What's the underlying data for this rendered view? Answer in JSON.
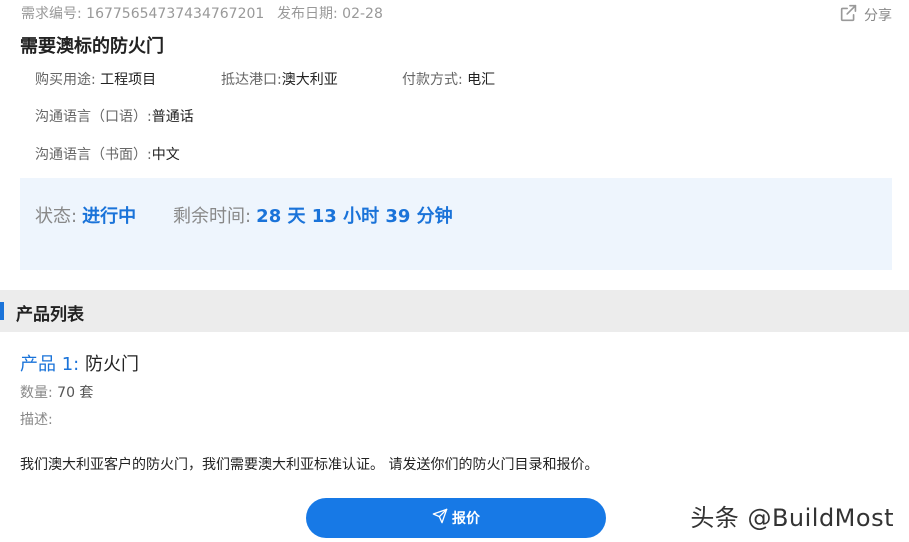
{
  "meta": {
    "req_no": "需求编号: 16775654737434767201",
    "pub_date": "发布日期: 02-28"
  },
  "share": {
    "label": "分享",
    "icon": "share-icon"
  },
  "title": "需要澳标的防火门",
  "info": {
    "purpose_label": "购买用途:",
    "purpose_value": "工程项目",
    "port_label": "抵达港口:",
    "port_value": "澳大利亚",
    "payment_label": "付款方式:",
    "payment_value": "电汇",
    "spoken_label": "沟通语言（口语）:",
    "spoken_value": "普通话",
    "written_label": "沟通语言（书面）:",
    "written_value": "中文"
  },
  "status": {
    "status_label": "状态:",
    "status_value": "进行中",
    "remaining_label": "剩余时间:",
    "remaining_value": "28 天 13 小时 39 分钟"
  },
  "section": {
    "title": "产品列表"
  },
  "product": {
    "label": "产品 1:",
    "name": "防火门",
    "qty_label": "数量:",
    "qty_value": "70 套",
    "desc_label": "描述:",
    "desc_text": "我们澳大利亚客户的防火门，我们需要澳大利亚标准认证。 请发送你们的防火门目录和报价。"
  },
  "quote_button": {
    "label": "报价",
    "icon": "paper-plane-icon"
  },
  "watermark": "头条 @BuildMost",
  "colors": {
    "accent": "#1a73d9",
    "button": "#1779e6",
    "status_bg": "#eef5fd",
    "section_bg": "#ececec"
  }
}
